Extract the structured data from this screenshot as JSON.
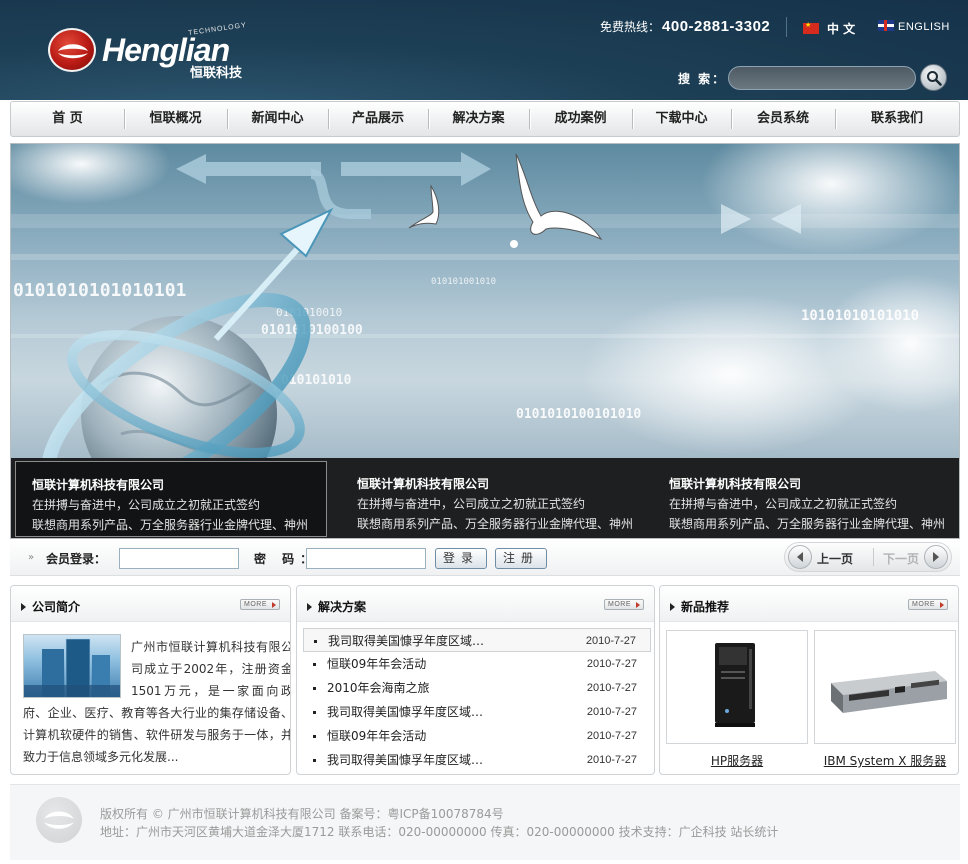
{
  "header": {
    "logo_tech": "TECHNOLOGY",
    "logo_word": "Henglian",
    "logo_cn": "恒联科技",
    "hotline_label": "免费热线：",
    "hotline_number": "400-2881-3302",
    "lang_cn": "中 文",
    "lang_en": "ENGLISH",
    "search_label": "搜 索：",
    "search_value": ""
  },
  "nav": {
    "items": [
      "首 页",
      "恒联概况",
      "新闻中心",
      "产品展示",
      "解决方案",
      "成功案例",
      "下载中心",
      "会员系统",
      "联系我们"
    ]
  },
  "banner": {
    "binary_texts": [
      "0101010101010101",
      "0101010100100",
      "010101010",
      "010101001010",
      "0101010010",
      "0101010100101010",
      "10101010101010"
    ],
    "strip": [
      {
        "title": "恒联计算机科技有限公司",
        "line1": "在拼搏与奋进中，公司成立之初就正式签约",
        "line2": "联想商用系列产品、万全服务器行业金牌代理、神州"
      },
      {
        "title": "恒联计算机科技有限公司",
        "line1": "在拼搏与奋进中，公司成立之初就正式签约",
        "line2": "联想商用系列产品、万全服务器行业金牌代理、神州"
      },
      {
        "title": "恒联计算机科技有限公司",
        "line1": "在拼搏与奋进中，公司成立之初就正式签约",
        "line2": "联想商用系列产品、万全服务器行业金牌代理、神州"
      }
    ]
  },
  "login": {
    "member_label": "会员登录：",
    "password_label": "密 码：",
    "username_value": "",
    "password_value": "",
    "login_button": "登录",
    "register_button": "注册",
    "prev_label": "上一页",
    "next_label": "下一页"
  },
  "about": {
    "title": "公司简介",
    "more": "MORE",
    "text": "广州市恒联计算机科技有限公司成立于2002年，注册资金1501万元，是一家面向政府、企业、医疗、教育等各大行业的集存储设备、计算机软硬件的销售、软件研发与服务于一体，并致力于信息领域多元化发展..."
  },
  "solutions": {
    "title": "解决方案",
    "more": "MORE",
    "rows": [
      {
        "title": "我司取得美国慷孚年度区域…",
        "date": "2010-7-27"
      },
      {
        "title": "恒联09年年会活动",
        "date": "2010-7-27"
      },
      {
        "title": "2010年会海南之旅",
        "date": "2010-7-27"
      },
      {
        "title": "我司取得美国慷孚年度区域…",
        "date": "2010-7-27"
      },
      {
        "title": "恒联09年年会活动",
        "date": "2010-7-27"
      },
      {
        "title": "我司取得美国慷孚年度区域…",
        "date": "2010-7-27"
      }
    ]
  },
  "products": {
    "title": "新品推荐",
    "more": "MORE",
    "items": [
      {
        "name": "HP服务器"
      },
      {
        "name": "IBM System X 服务器"
      }
    ]
  },
  "footer": {
    "line1": "版权所有 © 广州市恒联计算机科技有限公司 备案号：粤ICP备10078784号",
    "line2": "地址：广州市天河区黄埔大道金泽大厦1712  联系电话：020-00000000 传真：020-00000000  技术支持：广企科技  站长统计"
  },
  "colors": {
    "header_bg": "#1d3f55",
    "strip_bg": "#1e1f20",
    "logo_red": "#b81a14"
  }
}
